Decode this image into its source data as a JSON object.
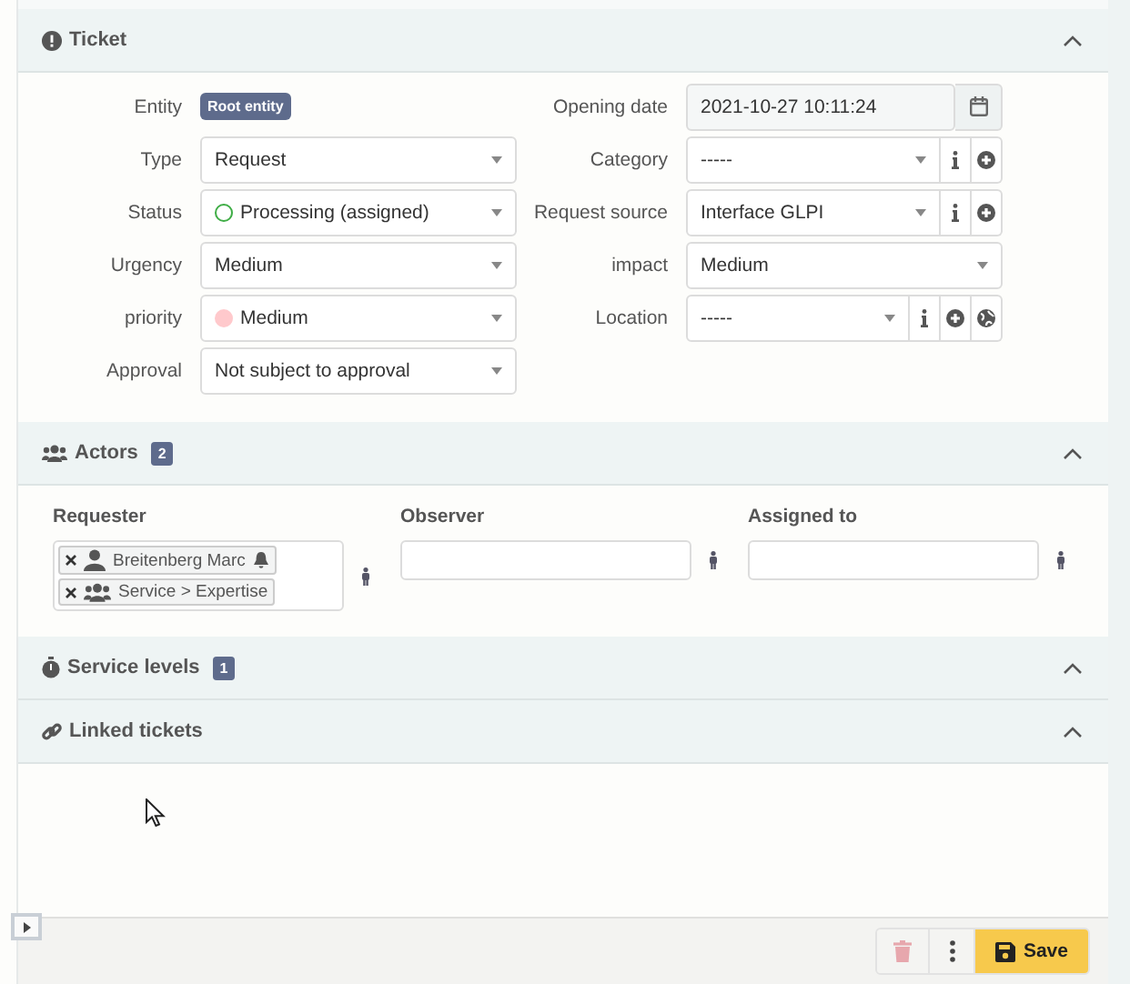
{
  "sections": [
    {
      "kind": "ticket",
      "title": "Ticket",
      "left_fields": [
        {
          "label": "Entity",
          "kind": "badge",
          "value": "Root entity"
        },
        {
          "label": "Type",
          "kind": "select",
          "value": "Request"
        },
        {
          "label": "Status",
          "kind": "select",
          "value": "Processing (assigned)",
          "marker": {
            "kind": "ring",
            "color": "#3fad46"
          }
        },
        {
          "label": "Urgency",
          "kind": "select",
          "value": "Medium"
        },
        {
          "label": "priority",
          "kind": "select",
          "value": "Medium",
          "marker": {
            "kind": "filled",
            "color": "#ffc9cc"
          }
        },
        {
          "label": "Approval",
          "kind": "select",
          "value": "Not subject to approval"
        }
      ],
      "right_fields": [
        {
          "label": "Opening date",
          "kind": "date",
          "value": "2021-10-27 10:11:24"
        },
        {
          "label": "Category",
          "kind": "select",
          "value": "-----",
          "actions": [
            {
              "kind": "info"
            },
            {
              "kind": "add"
            }
          ]
        },
        {
          "label": "Request source",
          "kind": "select",
          "value": "Interface GLPI",
          "actions": [
            {
              "kind": "info"
            },
            {
              "kind": "add"
            }
          ]
        },
        {
          "label": "impact",
          "kind": "select",
          "value": "Medium"
        },
        {
          "label": "Location",
          "kind": "select",
          "value": "-----",
          "actions": [
            {
              "kind": "info"
            },
            {
              "kind": "add"
            },
            {
              "kind": "globe"
            }
          ]
        }
      ]
    },
    {
      "kind": "actors",
      "title": "Actors",
      "count": "2",
      "columns": [
        {
          "label": "Requester",
          "items": [
            {
              "kind": "user",
              "name": "Breitenberg Marc",
              "notify": true
            },
            {
              "kind": "group",
              "name": "Service > Expertise",
              "notify": false
            }
          ]
        },
        {
          "label": "Observer"
        },
        {
          "label": "Assigned to"
        }
      ]
    },
    {
      "kind": "service_levels",
      "title": "Service levels",
      "count": "1"
    },
    {
      "kind": "linked_tickets",
      "title": "Linked tickets"
    }
  ],
  "footer": {
    "actions": [
      {
        "kind": "delete"
      },
      {
        "kind": "more"
      },
      {
        "kind": "save",
        "label": "Save"
      }
    ]
  }
}
